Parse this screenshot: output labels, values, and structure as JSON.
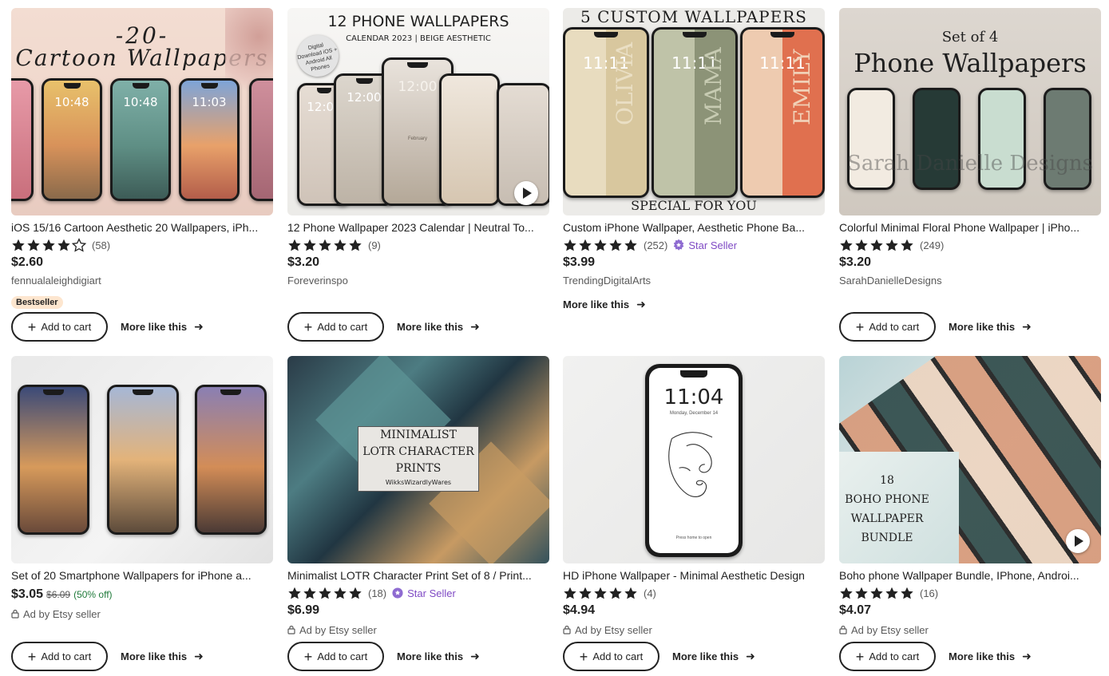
{
  "products": [
    {
      "title": "iOS 15/16 Cartoon Aesthetic 20 Wallpapers, iPh...",
      "rating": 4,
      "reviews": "(58)",
      "star_seller": "",
      "price": "$2.60",
      "old_price": "",
      "discount": "",
      "shop": "fennualaleighdigiart",
      "ad": "",
      "badge": "Bestseller",
      "image_text": {
        "line1": "-20-",
        "line2": "Cartoon Wallpapers",
        "times": [
          "10:48",
          "10:48",
          "11:03"
        ]
      },
      "has_video": false
    },
    {
      "title": "12 Phone Wallpaper 2023 Calendar | Neutral To...",
      "rating": 5,
      "reviews": "(9)",
      "star_seller": "",
      "price": "$3.20",
      "old_price": "",
      "discount": "",
      "shop": "Foreverinspo",
      "ad": "",
      "badge": "",
      "image_text": {
        "line1": "12 PHONE WALLPAPERS",
        "line2": "CALENDAR 2023 | BEIGE AESTHETIC",
        "sticker": "Digital Download iOS + Android All Phones",
        "times": [
          "12:00",
          "12:00",
          "12:00"
        ],
        "month": "February"
      },
      "has_video": true
    },
    {
      "title": "Custom iPhone Wallpaper, Aesthetic Phone Ba...",
      "rating": 5,
      "reviews": "(252)",
      "star_seller": "Star Seller",
      "price": "$3.99",
      "old_price": "",
      "discount": "",
      "shop": "TrendingDigitalArts",
      "ad": "",
      "badge": "",
      "image_text": {
        "line1": "5 CUSTOM WALLPAPERS",
        "line2": "SPECIAL FOR YOU",
        "names": [
          "OLIVIA",
          "MAMA",
          "EMILY"
        ],
        "times": [
          "11:11",
          "11:11",
          "11:11"
        ]
      },
      "has_video": false
    },
    {
      "title": "Colorful Minimal Floral Phone Wallpaper | iPho...",
      "rating": 5,
      "reviews": "(249)",
      "star_seller": "",
      "price": "$3.20",
      "old_price": "",
      "discount": "",
      "shop": "SarahDanielleDesigns",
      "ad": "",
      "badge": "",
      "image_text": {
        "line1": "Set of 4",
        "line2": "Phone Wallpapers",
        "watermark": "Sarah Danielle Designs"
      },
      "has_video": false
    },
    {
      "title": "Set of 20 Smartphone Wallpapers for iPhone a...",
      "rating": 0,
      "reviews": "",
      "star_seller": "",
      "price": "$3.05",
      "old_price": "$6.09",
      "discount": "(50% off)",
      "shop": "",
      "ad": "Ad by Etsy seller",
      "badge": "",
      "image_text": {},
      "has_video": false
    },
    {
      "title": "Minimalist LOTR Character Print Set of 8 / Print...",
      "rating": 5,
      "reviews": "(18)",
      "star_seller": "Star Seller",
      "price": "$6.99",
      "old_price": "",
      "discount": "",
      "shop": "",
      "ad": "Ad by Etsy seller",
      "badge": "",
      "image_text": {
        "line1": "MINIMALIST",
        "line2": "LOTR CHARACTER",
        "line3": "PRINTS",
        "watermark": "WikksWizardlyWares"
      },
      "has_video": false
    },
    {
      "title": "HD iPhone Wallpaper - Minimal Aesthetic Design",
      "rating": 5,
      "reviews": "(4)",
      "star_seller": "",
      "price": "$4.94",
      "old_price": "",
      "discount": "",
      "shop": "",
      "ad": "Ad by Etsy seller",
      "badge": "",
      "image_text": {
        "time": "11:04",
        "date": "Monday, December 14",
        "hint": "Press home to open"
      },
      "has_video": false
    },
    {
      "title": "Boho phone Wallpaper Bundle, IPhone, Androi...",
      "rating": 5,
      "reviews": "(16)",
      "star_seller": "",
      "price": "$4.07",
      "old_price": "",
      "discount": "",
      "shop": "",
      "ad": "Ad by Etsy seller",
      "badge": "",
      "image_text": {
        "line1": "18",
        "line2": "BOHO PHONE",
        "line3": "WALLPAPER",
        "line4": "BUNDLE"
      },
      "has_video": true
    }
  ],
  "labels": {
    "add_to_cart": "Add to cart",
    "more_like_this": "More like this"
  },
  "icons": {
    "star": "star-icon",
    "star_seller_badge": "star-seller-badge-icon",
    "plus": "plus-icon",
    "arrow": "arrow-right-icon",
    "play": "play-icon",
    "ad_lock": "ad-icon"
  },
  "colors": {
    "text": "#222222",
    "muted": "#595959",
    "star_seller": "#7f4ac4",
    "discount": "#1f7a3a",
    "bestseller_bg": "#fde6cf"
  }
}
